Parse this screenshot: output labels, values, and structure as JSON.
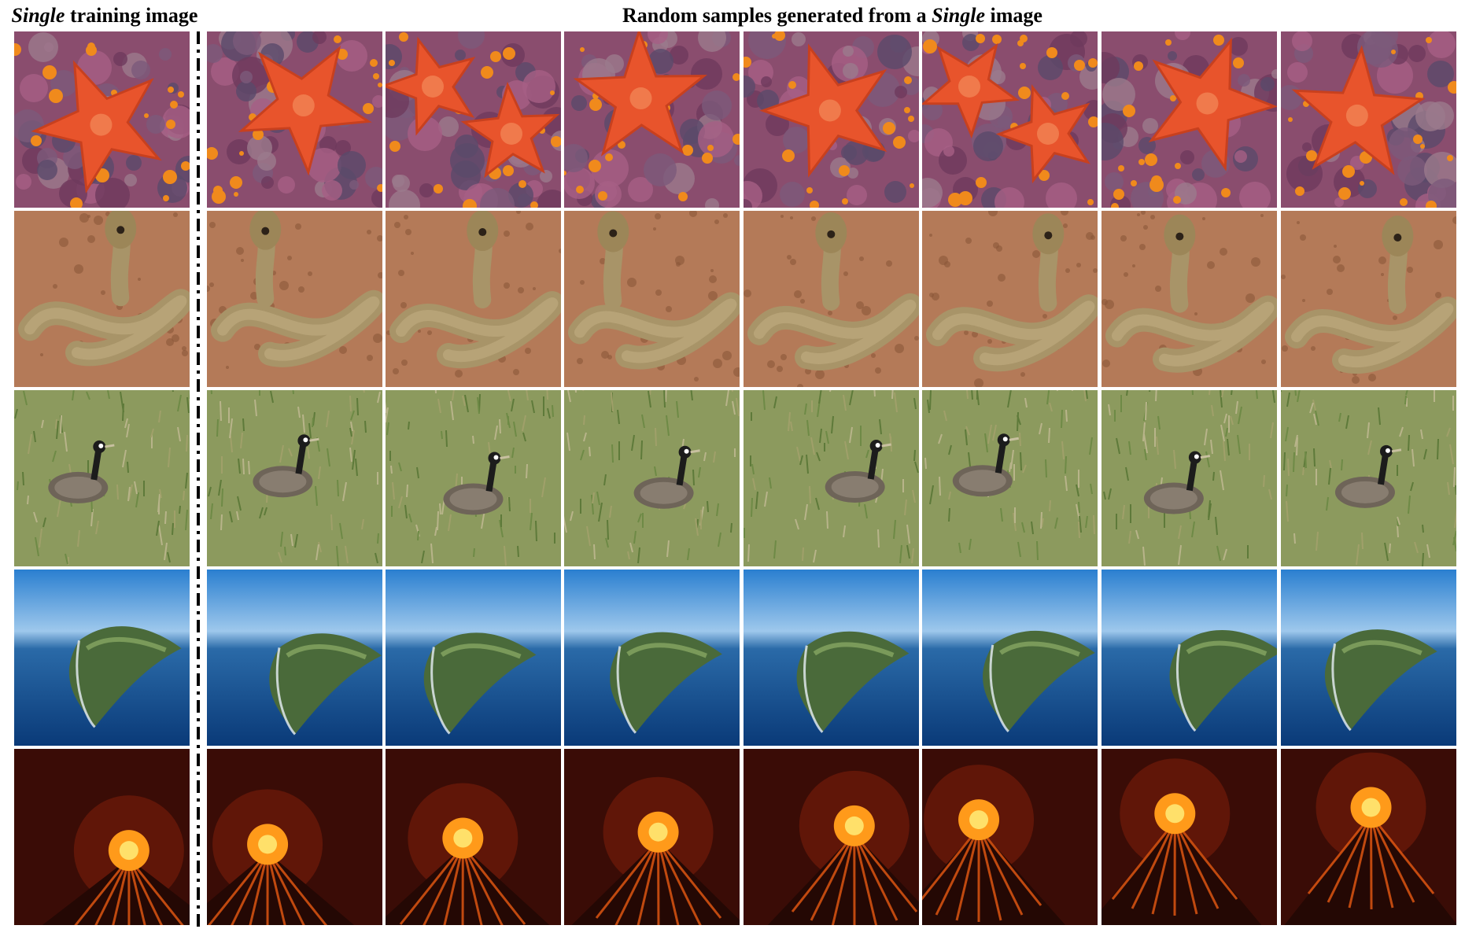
{
  "header": {
    "left_emph": "Single",
    "left_rest": " training image",
    "right_pre": "Random samples generated from a ",
    "right_emph": "Single",
    "right_post": " image"
  },
  "columns": [
    "training",
    "sample-1",
    "sample-2",
    "sample-3",
    "sample-4",
    "sample-5",
    "sample-6",
    "sample-7"
  ],
  "rows": [
    {
      "id": "starfish",
      "scene": "starfish"
    },
    {
      "id": "cobra",
      "scene": "cobra"
    },
    {
      "id": "bustard",
      "scene": "bustard"
    },
    {
      "id": "island",
      "scene": "island"
    },
    {
      "id": "volcano",
      "scene": "volcano"
    }
  ]
}
